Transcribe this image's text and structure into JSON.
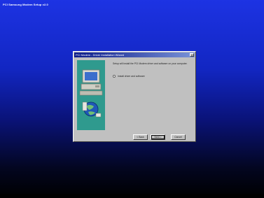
{
  "screen": {
    "title": "PCI Samsung Modem Setup v2.0"
  },
  "dialog": {
    "title": "PCI Modem - Driver Installation Wizard",
    "close_glyph": "×",
    "message": "Setup will install the PCI Modem driver and software on your computer.",
    "radio_label": "Install driver and software",
    "buttons": {
      "back": "< Back",
      "next": "Next >",
      "cancel": "Cancel"
    }
  },
  "icons": [
    "computer-icon",
    "globe-icon",
    "close-icon",
    "radio-icon"
  ],
  "colors": {
    "desktop_top": "#1d33e3",
    "desktop_bottom": "#000000",
    "dialog_face": "#c0c0c0",
    "titlebar_start": "#0a1a8a",
    "titlebar_end": "#7a93d8",
    "art_panel": "#2f9a8e"
  }
}
